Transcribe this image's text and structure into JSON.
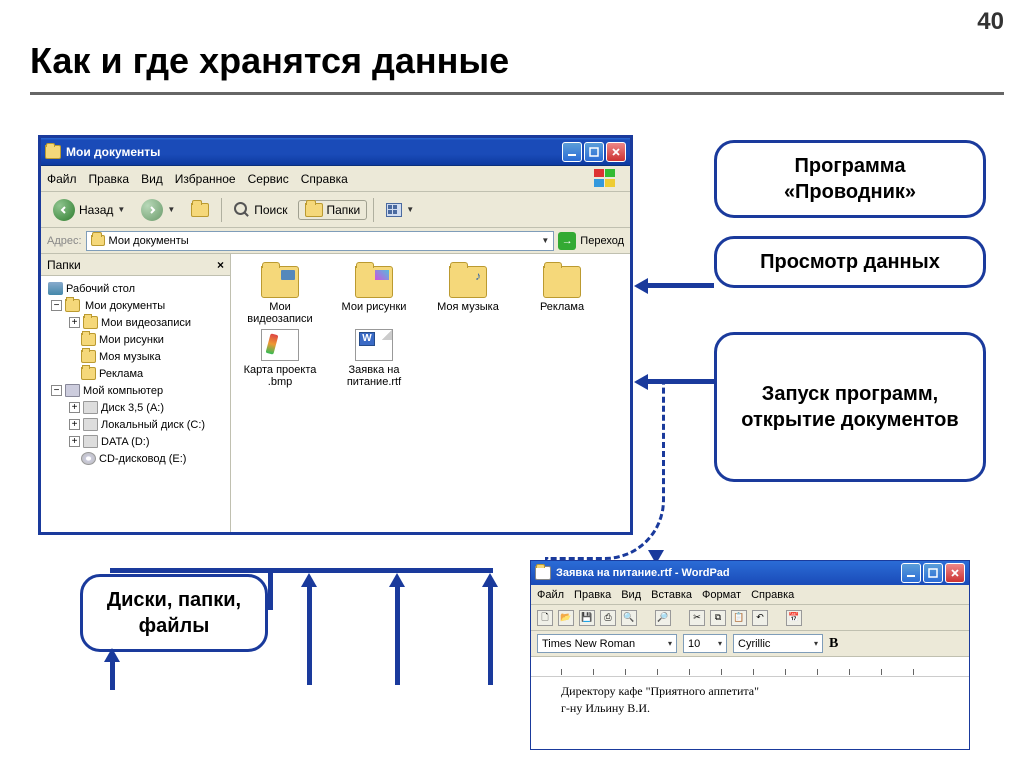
{
  "slide": {
    "number": "40",
    "title": "Как и где хранятся данные"
  },
  "explorer": {
    "title": "Мои документы",
    "menu": {
      "file": "Файл",
      "edit": "Правка",
      "view": "Вид",
      "favorites": "Избранное",
      "tools": "Сервис",
      "help": "Справка"
    },
    "toolbar": {
      "back": "Назад",
      "search": "Поиск",
      "folders": "Папки"
    },
    "address": {
      "label": "Адрес:",
      "value": "Мои документы",
      "go": "Переход"
    },
    "sidepanel": {
      "title": "Папки"
    },
    "tree": {
      "desktop": "Рабочий стол",
      "mydocs": "Мои документы",
      "myvideo": "Мои видеозаписи",
      "mypics": "Мои рисунки",
      "mymusic": "Моя музыка",
      "reklama": "Реклама",
      "mypc": "Мой компьютер",
      "floppy": "Диск 3,5 (A:)",
      "localc": "Локальный диск (C:)",
      "datad": "DATA (D:)",
      "cdrom": "CD-дисковод (E:)"
    },
    "items": [
      {
        "icon": "folder-video",
        "label": "Мои видеозаписи"
      },
      {
        "icon": "folder-pics",
        "label": "Мои рисунки"
      },
      {
        "icon": "folder-music",
        "label": "Моя музыка"
      },
      {
        "icon": "folder",
        "label": "Реклама"
      },
      {
        "icon": "bmp",
        "label": "Карта проекта .bmp"
      },
      {
        "icon": "rtf",
        "label": "Заявка на питание.rtf"
      }
    ]
  },
  "callouts": {
    "program": "Программа «Проводник»",
    "view": "Просмотр данных",
    "launch": "Запуск программ, открытие документов",
    "disks": "Диски, папки, файлы"
  },
  "wordpad": {
    "title": "Заявка на питание.rtf - WordPad",
    "menu": {
      "file": "Файл",
      "edit": "Правка",
      "view": "Вид",
      "insert": "Вставка",
      "format": "Формат",
      "help": "Справка"
    },
    "font": "Times New Roman",
    "size": "10",
    "charset": "Cyrillic",
    "bold": "B",
    "ruler_marks": [
      "1",
      "2",
      "3",
      "4",
      "5",
      "6",
      "7",
      "8",
      "9",
      "10",
      "11",
      "12"
    ],
    "body_line1": "Директору кафе \"Приятного аппетита\"",
    "body_line2": "г-ну Ильину В.И."
  }
}
